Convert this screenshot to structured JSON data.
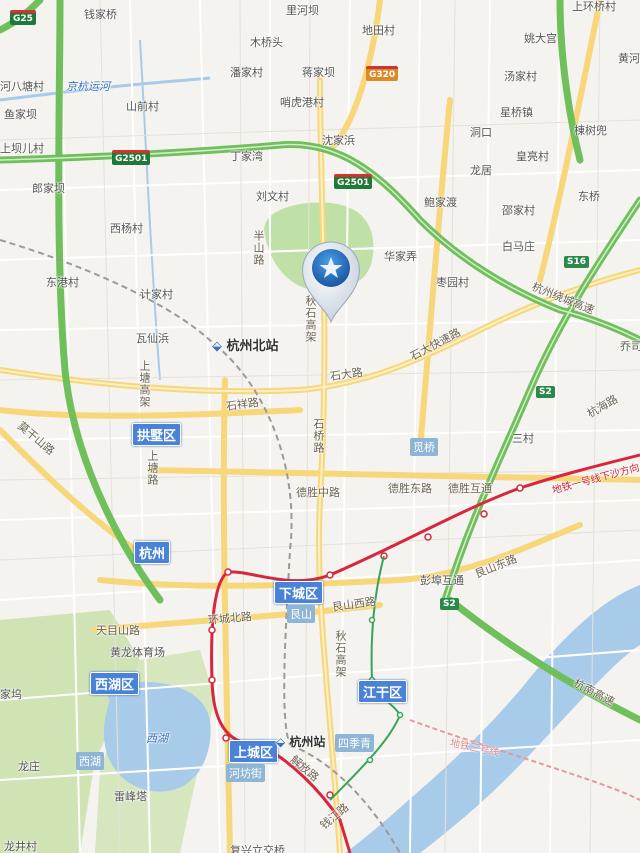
{
  "map": {
    "shields": {
      "g25": "G25",
      "g2501_left": "G2501",
      "g2501_right": "G2501",
      "g320": "G320",
      "s16": "S16",
      "s2_east": "S2",
      "s2_south": "S2"
    },
    "districts": {
      "gongshu": "拱墅区",
      "hangzhou": "杭州",
      "xiacheng": "下城区",
      "xihu": "西湖区",
      "jianggan": "江干区",
      "shangcheng": "上城区"
    },
    "stations": {
      "north": "杭州北站",
      "main": "杭州站"
    },
    "pois": {
      "jueqiao": "觅桥",
      "genshan": "艮山",
      "siji_qing": "四季青",
      "xihu_poi": "西湖",
      "hefang": "河坊街"
    },
    "water": {
      "canal": "京杭运河",
      "xihu_lake": "西湖"
    },
    "roads": {
      "banshan": "半山路",
      "qiushi_n": "秋石高架",
      "shida": "石大路",
      "shida_expressway": "石大快速路",
      "shixiang": "石祥路",
      "shangtang": "上塘高架",
      "shangtang_road": "上塘路",
      "shitong": "石桥路",
      "desheng_mid": "德胜中路",
      "desheng_east": "德胜东路",
      "desheng_hutong": "德胜互通",
      "genshan_east": "艮山东路",
      "genshan_west": "艮山西路",
      "huancheng_north": "环城北路",
      "tianmushan": "天目山路",
      "qiushi_s": "秋石高架",
      "hangnan": "杭南高速",
      "raocheng": "杭州绕城高速",
      "hanghai": "杭海路",
      "moganshan": "莫干山路",
      "jiefang": "解放路",
      "qianjiang": "钱江路"
    },
    "metro": {
      "line1": "地铁一号线下沙方向",
      "line": "地铁三号线"
    },
    "places": [
      {
        "t": "钱家桥"
      },
      {
        "t": "里河坝"
      },
      {
        "t": "地田村"
      },
      {
        "t": "上环桥村"
      },
      {
        "t": "木桥头"
      },
      {
        "t": "姚大宫"
      },
      {
        "t": "黄河"
      },
      {
        "t": "河八塘村"
      },
      {
        "t": "潘家村"
      },
      {
        "t": "蒋家坝"
      },
      {
        "t": "汤家村"
      },
      {
        "t": "鱼家坝"
      },
      {
        "t": "山前村"
      },
      {
        "t": "哨虎港村"
      },
      {
        "t": "星桥镇"
      },
      {
        "t": "上坝儿村"
      },
      {
        "t": "沈家浜"
      },
      {
        "t": "洞口"
      },
      {
        "t": "棟树兜"
      },
      {
        "t": "丁家湾"
      },
      {
        "t": "皇亮村"
      },
      {
        "t": "郎家坝"
      },
      {
        "t": "刘文村"
      },
      {
        "t": "龙居"
      },
      {
        "t": "东桥"
      },
      {
        "t": "鲍家渡"
      },
      {
        "t": "邵家村"
      },
      {
        "t": "西杨村"
      },
      {
        "t": "华家弄"
      },
      {
        "t": "白马庄"
      },
      {
        "t": "东港村"
      },
      {
        "t": "枣园村"
      },
      {
        "t": "计家村"
      },
      {
        "t": "瓦仙浜"
      },
      {
        "t": "乔司"
      },
      {
        "t": "三村"
      },
      {
        "t": "彭埠互通"
      },
      {
        "t": "黄龙体育场"
      },
      {
        "t": "家坞"
      },
      {
        "t": "龙庄"
      },
      {
        "t": "雷峰塔"
      },
      {
        "t": "龙井村"
      },
      {
        "t": "复兴立交桥"
      }
    ]
  }
}
